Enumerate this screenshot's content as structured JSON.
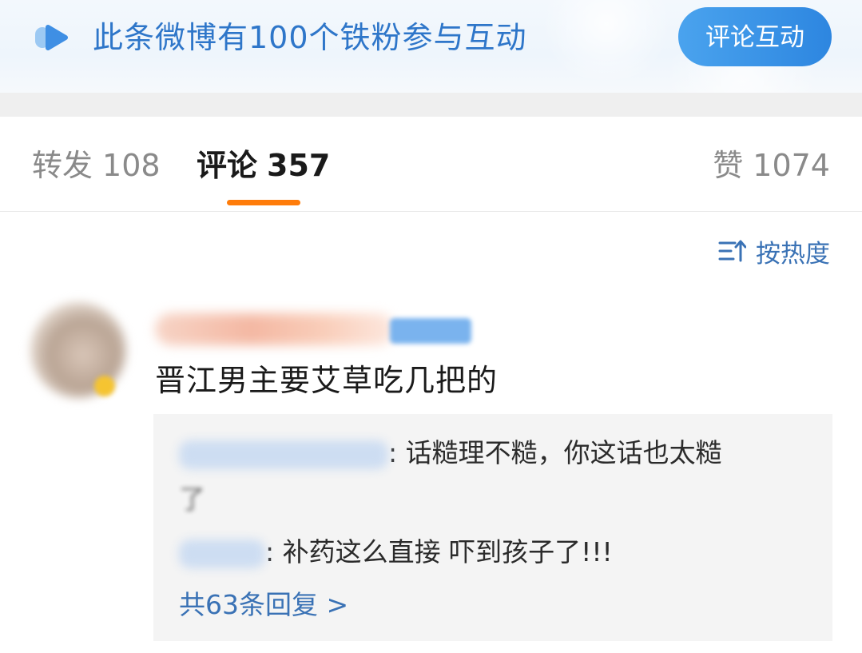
{
  "banner": {
    "text": "此条微博有100个铁粉参与互动",
    "button_label": "评论互动",
    "icon": "weibo-fan-icon",
    "accent_color": "#2e76c9"
  },
  "tabs": {
    "repost": {
      "label": "转发",
      "count": "108"
    },
    "comments": {
      "label": "评论",
      "count": "357",
      "active": true
    },
    "likes": {
      "label": "赞",
      "count": "1074"
    },
    "active_underline_color": "#ff7c0a"
  },
  "sort": {
    "label": "按热度",
    "icon": "sort-icon"
  },
  "comment": {
    "text": "晋江男主要艾草吃几把的",
    "replies": [
      {
        "text": ": 话糙理不糙，你这话也太糙"
      },
      {
        "text": ": 补药这么直接 吓到孩子了!!!"
      }
    ],
    "more_replies_label": "共63条回复 >"
  }
}
